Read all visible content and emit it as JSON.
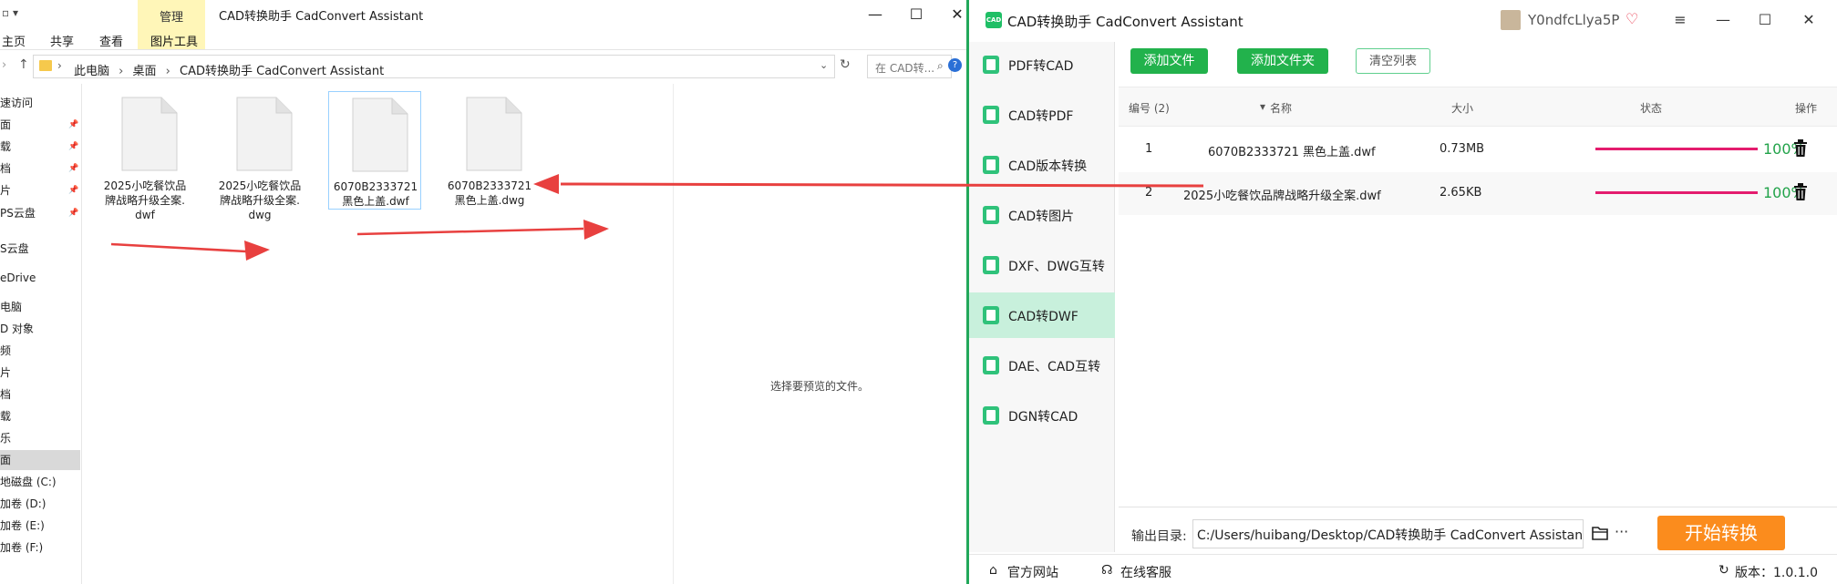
{
  "explorer": {
    "ribbon": {
      "context_group": "管理",
      "tabs": [
        "主页",
        "共享",
        "查看",
        "图片工具"
      ]
    },
    "window_title": "CAD转换助手 CadConvert Assistant",
    "address": {
      "path": [
        "此电脑",
        "桌面",
        "CAD转换助手 CadConvert Assistant"
      ],
      "search_placeholder": "在 CAD转..."
    },
    "nav_items": [
      {
        "label": "速访问",
        "pinned": false
      },
      {
        "label": "面",
        "pinned": true
      },
      {
        "label": "载",
        "pinned": true
      },
      {
        "label": "档",
        "pinned": true
      },
      {
        "label": "片",
        "pinned": true
      },
      {
        "label": "PS云盘",
        "pinned": true
      },
      {
        "label": "S云盘",
        "pinned": false
      },
      {
        "label": "eDrive",
        "pinned": false
      },
      {
        "label": "电脑",
        "pinned": false
      },
      {
        "label": "D 对象",
        "pinned": false
      },
      {
        "label": "频",
        "pinned": false
      },
      {
        "label": "片",
        "pinned": false
      },
      {
        "label": "档",
        "pinned": false
      },
      {
        "label": "载",
        "pinned": false
      },
      {
        "label": "乐",
        "pinned": false
      },
      {
        "label": "面",
        "pinned": false,
        "selected": true
      },
      {
        "label": "地磁盘 (C:)",
        "pinned": false
      },
      {
        "label": "加卷 (D:)",
        "pinned": false
      },
      {
        "label": "加卷 (E:)",
        "pinned": false
      },
      {
        "label": "加卷 (F:)",
        "pinned": false
      }
    ],
    "files": [
      {
        "line1": "2025小吃餐饮品",
        "line2": "牌战略升级全案.",
        "line3": "dwf"
      },
      {
        "line1": "2025小吃餐饮品",
        "line2": "牌战略升级全案.",
        "line3": "dwg"
      },
      {
        "line1": "6070B2333721",
        "line2": "黑色上盖.dwf",
        "line3": "",
        "selected": true
      },
      {
        "line1": "6070B2333721",
        "line2": "黑色上盖.dwg",
        "line3": ""
      }
    ],
    "preview_text": "选择要预览的文件。"
  },
  "app": {
    "logo_text": "CAD",
    "title": "CAD转换助手 CadConvert Assistant",
    "user_name": "Y0ndfcLlya5P",
    "sidebar": [
      {
        "label": "PDF转CAD",
        "active": false
      },
      {
        "label": "CAD转PDF",
        "active": false
      },
      {
        "label": "CAD版本转换",
        "active": false
      },
      {
        "label": "CAD转图片",
        "active": false
      },
      {
        "label": "DXF、DWG互转",
        "active": false
      },
      {
        "label": "CAD转DWF",
        "active": true
      },
      {
        "label": "DAE、CAD互转",
        "active": false
      },
      {
        "label": "DGN转CAD",
        "active": false
      }
    ],
    "toolbar": {
      "add_file": "添加文件",
      "add_folder": "添加文件夹",
      "clear_list": "清空列表"
    },
    "table": {
      "headers": {
        "index": "编号 (2)",
        "name": "名称",
        "size": "大小",
        "status": "状态",
        "action": "操作"
      },
      "rows": [
        {
          "index": "1",
          "name": "6070B2333721 黑色上盖.dwf",
          "size": "0.73MB",
          "progress": 100,
          "percent": "100%"
        },
        {
          "index": "2",
          "name": "2025小吃餐饮品牌战略升级全案.dwf",
          "size": "2.65KB",
          "progress": 100,
          "percent": "100%"
        }
      ]
    },
    "output": {
      "label": "输出目录:",
      "path": "C:/Users/huibang/Desktop/CAD转换助手 CadConvert Assistant"
    },
    "start_button": "开始转换",
    "status": {
      "website": "官方网站",
      "support": "在线客服",
      "version": "版本：1.0.1.0"
    },
    "colors": {
      "accent": "#22b24c",
      "progress": "#e41c6e",
      "start": "#fb8c1d",
      "annotation_arrow": "#e8403f"
    }
  }
}
